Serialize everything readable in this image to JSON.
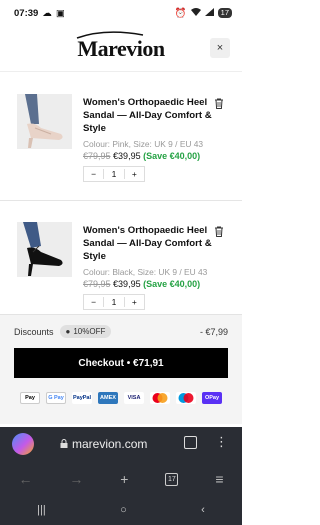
{
  "status": {
    "time": "07:39",
    "battery": "17"
  },
  "header": {
    "logo": "Marevion",
    "close": "×"
  },
  "items": [
    {
      "title": "Women's Orthopaedic Heel Sandal — All-Day Comfort & Style",
      "variant": "Colour: Pink, Size: UK 9 / EU 43",
      "old_price": "€79,95",
      "new_price": "€39,95",
      "save": "(Save €40,00)",
      "qty": "1",
      "minus": "−",
      "plus": "+",
      "shoe_color": "#e8d3c8"
    },
    {
      "title": "Women's Orthopaedic Heel Sandal — All-Day Comfort & Style",
      "variant": "Colour: Black, Size: UK 9 / EU 43",
      "old_price": "€79,95",
      "new_price": "€39,95",
      "save": "(Save €40,00)",
      "qty": "1",
      "minus": "−",
      "plus": "+",
      "shoe_color": "#111111"
    }
  ],
  "footer": {
    "discounts_label": "Discounts",
    "discount_code": "10%OFF",
    "discount_amount": "- €7,99",
    "checkout_label": "Checkout • €71,91",
    "payments": [
      "Pay",
      "G Pay",
      "PayPal",
      "AMEX",
      "VISA",
      "MC",
      "Maestro",
      "OPay"
    ]
  },
  "browser": {
    "url": "marevion.com",
    "tab_count": "17"
  }
}
